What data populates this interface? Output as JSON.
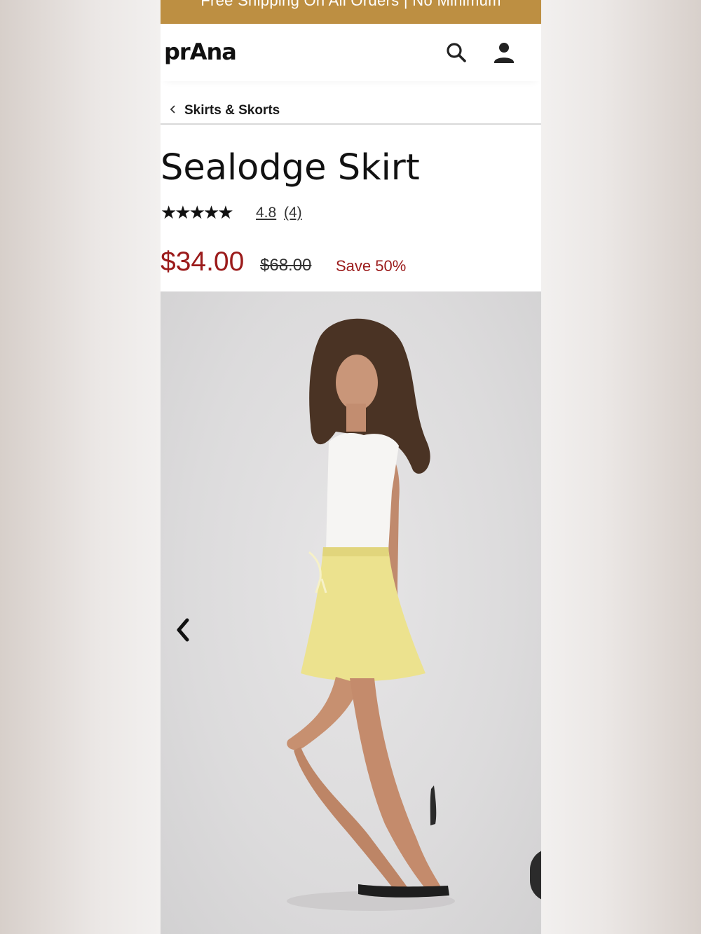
{
  "promo": {
    "text": "Free Shipping On All Orders | No Minimum"
  },
  "header": {
    "logo": "prAna",
    "search_icon": "search-icon",
    "account_icon": "user-icon"
  },
  "breadcrumb": {
    "label": "Skirts & Skorts"
  },
  "product": {
    "title": "Sealodge Skirt",
    "rating_stars": "★★★★★",
    "rating_value": "4.8",
    "rating_count": "(4)",
    "price_sale": "$34.00",
    "price_original": "$68.00",
    "discount": "Save 50%"
  },
  "colors": {
    "promo_bg": "#bd8f42",
    "sale_red": "#9b1b1b"
  }
}
